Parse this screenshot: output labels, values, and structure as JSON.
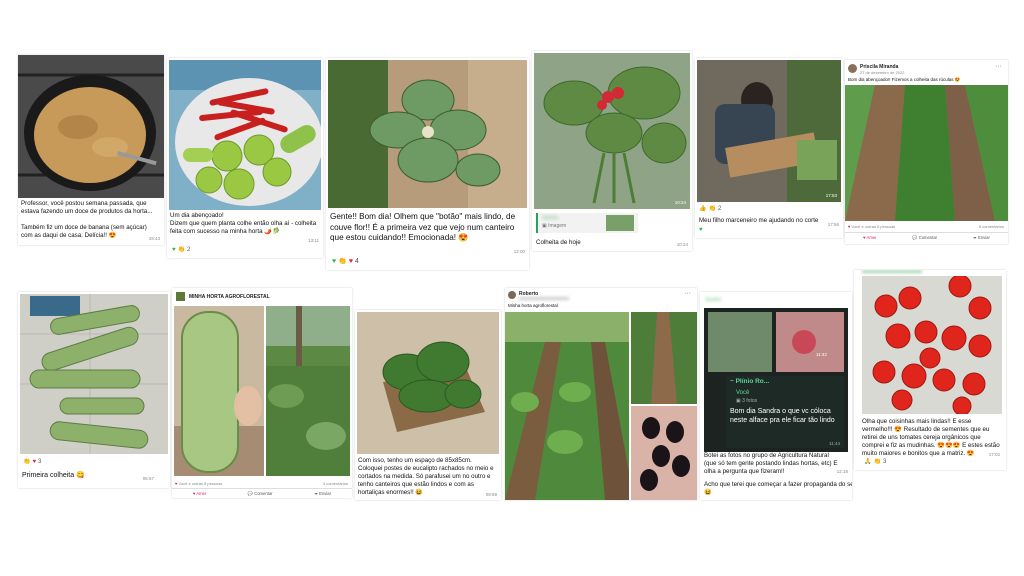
{
  "posts": [
    {
      "id": "doce",
      "caption": "Professor, você postou semana passada, que estava fazendo um doce de produtos da horta...\n\nTambém fiz um doce de banana (sem açúcar) com as daqui de casa. Delícia!! 😍",
      "time": "19:43"
    },
    {
      "id": "pimentas",
      "caption": "Um dia abençoado!\nDizem que quem planta colhe então olha aí - colheita feita com sucesso na minha horta 🌶️🥬",
      "time": "13:11",
      "reaction_count": "2"
    },
    {
      "id": "couve-flor",
      "caption": "Gente!! Bom dia! Olhem que \"botão\" mais lindo, de couve flor!! É a primeira vez que vejo num canteiro que estou cuidando!! Emocionada! 😍",
      "time": "12:00",
      "reaction_count": "4"
    },
    {
      "id": "colheita-hoje",
      "photo_time": "10:24",
      "quote_name": "Sandra",
      "quote_label": "Imagem",
      "caption": "Colheita de hoje",
      "time": "10:24"
    },
    {
      "id": "marceneiro",
      "photo_time": "17:53",
      "reaction_count": "2",
      "caption": "Meu filho marceneiro me ajudando no corte",
      "time": "17:56"
    },
    {
      "id": "priscila",
      "author": "Priscila Miranda",
      "date": "27 de dezembro de 2022",
      "text": "Bom dia abençoado!! Fizemos a colheita das rúculas 😍",
      "reactions_text": "Você e outras 6 pessoas",
      "comments_text": "5 comentários",
      "like": "Amei",
      "comment": "Comentar",
      "share": "Enviar"
    },
    {
      "id": "primeira-colheita",
      "reaction_count": "3",
      "caption": "Primeira colheita 😋",
      "time": "06:57"
    },
    {
      "id": "abobrinha",
      "group": "MINHA HORTA AGROFLORESTAL",
      "reactions_text": "Você e outras 8 pessoas",
      "comments_text": "3 comentários",
      "like": "Amei",
      "comment": "Comentar",
      "share": "Enviar"
    },
    {
      "id": "canteiro-eucalipto",
      "caption": "Com isso, tenho um espaço de 85x85cm. Coloquei postes de eucalipto rachados no meio e cortados na medida. Só parafusei um no outro e tenho canteiros que estão lindos e com as hortaliças enormes!! 😆",
      "time": "09:59"
    },
    {
      "id": "roberto",
      "author": "Roberto",
      "text": "Minha horta agroflorestal"
    },
    {
      "id": "alface",
      "quote_name": "Sandra",
      "photo_time": "11:42",
      "forward_name": "~ Plínio Ro...",
      "you_label": "Você",
      "photos_label": "3 fotos",
      "bubble_text": "Bom dia  Sandra o que vc cóloca neste alface pra ele ficar tão lindo",
      "bubble_time": "11:44",
      "caption": "Botei as fotos no grupo de Agricultura Natural (que só tem gente postando lindas hortas, etc) E olha a pergunta que fizeram!!",
      "time": "12:18",
      "caption2": "Acho que terei que começar a fazer propaganda do seu curso. 😆"
    },
    {
      "id": "tomates",
      "caption": "Olha que coisinhas mais lindas!! E esse vermelho!!! 😍 Resultado de sementes que eu retirei de uns tomates cereja orgânicos que comprei e fiz as mudinhas. 😍😍😍 E estes estão muito maiores e bonitos que a matriz. 😍",
      "reaction_count": "3",
      "time": "17:02"
    }
  ],
  "colors": {
    "whatsapp_green": "#25a35a",
    "heart_red": "#d8263a",
    "facebook_red_love": "#e0245e"
  }
}
